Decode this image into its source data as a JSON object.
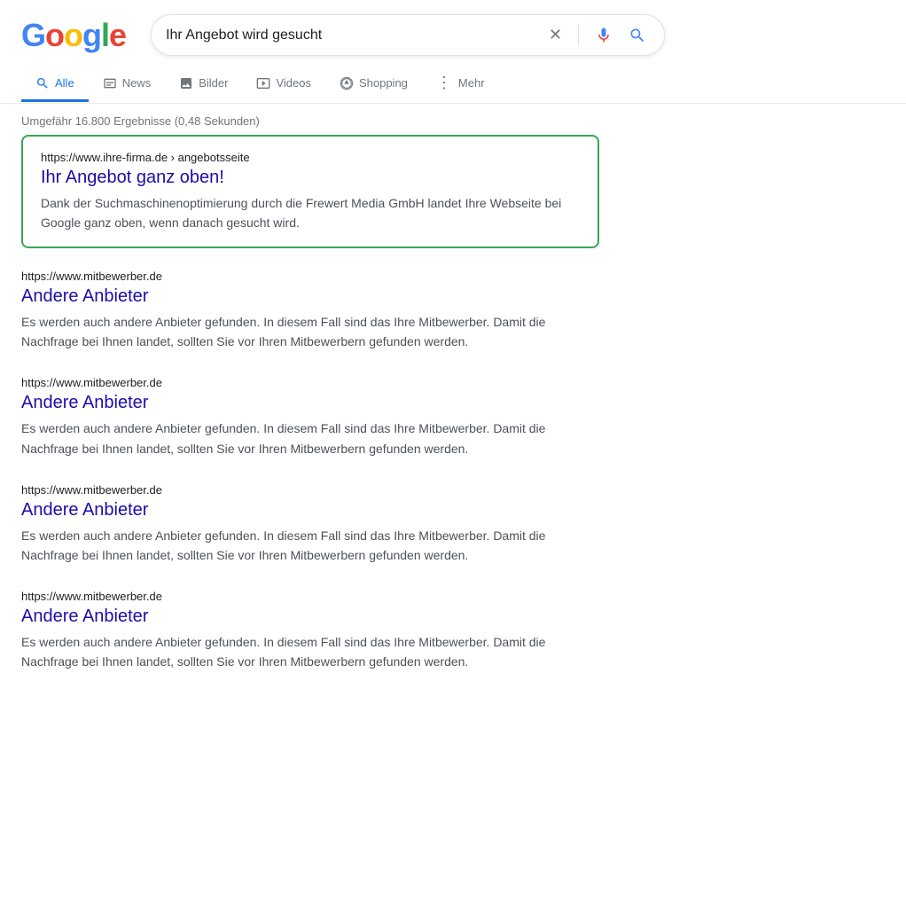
{
  "header": {
    "logo_letters": [
      "G",
      "o",
      "o",
      "g",
      "l",
      "e"
    ],
    "search_query": "Ihr Angebot wird gesucht",
    "clear_label": "×",
    "mic_label": "🎤",
    "search_label": "🔍"
  },
  "nav": {
    "tabs": [
      {
        "id": "alle",
        "label": "Alle",
        "icon": "🔍",
        "active": true
      },
      {
        "id": "news",
        "label": "News",
        "icon": "📰",
        "active": false
      },
      {
        "id": "bilder",
        "label": "Bilder",
        "icon": "🖼",
        "active": false
      },
      {
        "id": "videos",
        "label": "Videos",
        "icon": "▶",
        "active": false
      },
      {
        "id": "shopping",
        "label": "Shopping",
        "icon": "◇",
        "active": false
      },
      {
        "id": "mehr",
        "label": "Mehr",
        "icon": "⋮",
        "active": false
      }
    ]
  },
  "results": {
    "stats": "Umgefähr 16.800 Ergebnisse (0,48 Sekunden)",
    "featured": {
      "url": "https://www.ihre-firma.de › angebotsseite",
      "title": "Ihr Angebot ganz oben!",
      "description": "Dank der Suchmaschinenoptimierung durch die Frewert Media GmbH landet Ihre Webseite bei Google ganz oben, wenn danach gesucht wird."
    },
    "items": [
      {
        "url": "https://www.mitbewerber.de",
        "title": "Andere Anbieter",
        "description": "Es werden auch andere Anbieter gefunden. In diesem Fall sind das Ihre Mitbewerber. Damit die Nachfrage bei Ihnen landet, sollten Sie vor Ihren Mitbewerbern gefunden werden."
      },
      {
        "url": "https://www.mitbewerber.de",
        "title": "Andere Anbieter",
        "description": "Es werden auch andere Anbieter gefunden. In diesem Fall sind das Ihre Mitbewerber. Damit die Nachfrage bei Ihnen landet, sollten Sie vor Ihren Mitbewerbern gefunden werden."
      },
      {
        "url": "https://www.mitbewerber.de",
        "title": "Andere Anbieter",
        "description": "Es werden auch andere Anbieter gefunden. In diesem Fall sind das Ihre Mitbewerber. Damit die Nachfrage bei Ihnen landet, sollten Sie vor Ihren Mitbewerbern gefunden werden."
      },
      {
        "url": "https://www.mitbewerber.de",
        "title": "Andere Anbieter",
        "description": "Es werden auch andere Anbieter gefunden. In diesem Fall sind das Ihre Mitbewerber. Damit die Nachfrage bei Ihnen landet, sollten Sie vor Ihren Mitbewerbern gefunden werden."
      }
    ]
  }
}
